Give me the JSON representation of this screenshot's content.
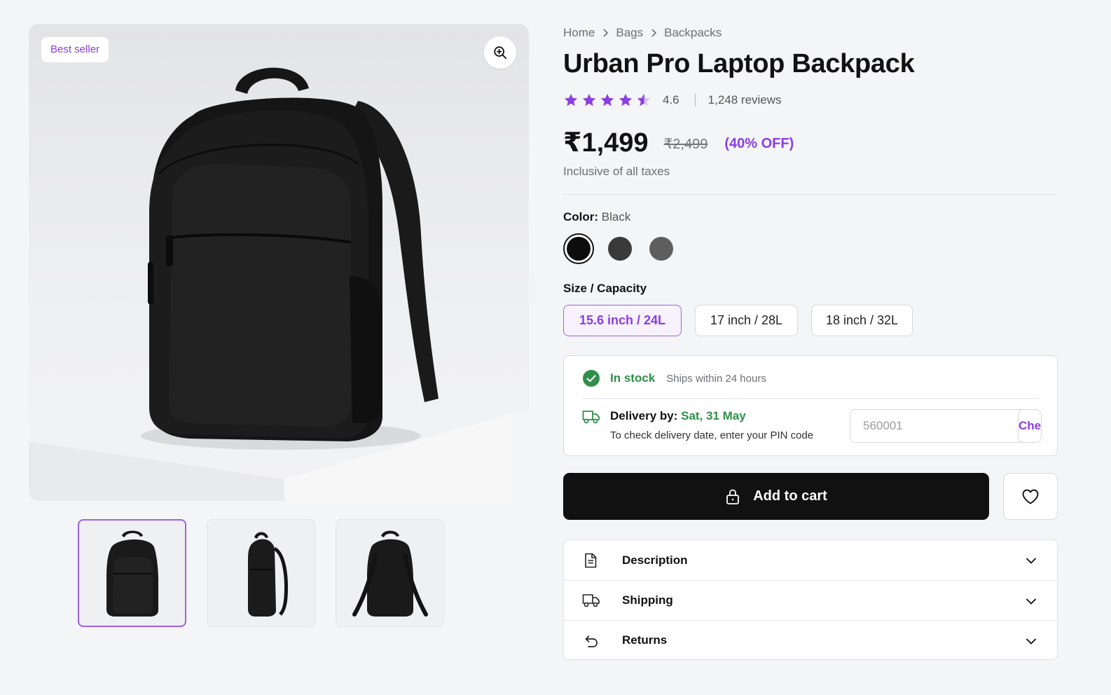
{
  "gallery": {
    "badge": "Best seller",
    "zoom_icon": "zoom-in-icon",
    "thumbnails": [
      {
        "view": "front",
        "selected": true
      },
      {
        "view": "side",
        "selected": false
      },
      {
        "view": "back",
        "selected": false
      }
    ]
  },
  "breadcrumb": [
    "Home",
    "Bags",
    "Backpacks"
  ],
  "product": {
    "title": "Urban Pro Laptop Backpack",
    "rating": "4.6",
    "rating_value": 4.6,
    "reviews": "1,248 reviews",
    "price": "₹1,499",
    "mrp": "₹2,499",
    "discount": "(40% OFF)",
    "tax_note": "Inclusive of all taxes"
  },
  "color": {
    "label": "Color:",
    "selected": "Black",
    "swatches": [
      {
        "name": "Black",
        "hex": "#0d0d0d",
        "selected": true
      },
      {
        "name": "Charcoal",
        "hex": "#3a3a3a",
        "selected": false
      },
      {
        "name": "Grey",
        "hex": "#5e5e5e",
        "selected": false
      }
    ]
  },
  "size": {
    "label": "Size / Capacity",
    "options": [
      {
        "label": "15.6 inch / 24L",
        "selected": true
      },
      {
        "label": "17 inch / 28L",
        "selected": false
      },
      {
        "label": "18 inch / 32L",
        "selected": false
      }
    ]
  },
  "availability": {
    "status": "In stock",
    "ships": "Ships within 24 hours",
    "delivery_label": "Delivery by:",
    "delivery_date": "Sat, 31 May",
    "delivery_hint": "To check delivery date, enter your PIN code",
    "pin_placeholder": "560001",
    "check_label": "Check"
  },
  "actions": {
    "add_to_cart": "Add to cart"
  },
  "accordion": [
    {
      "label": "Description",
      "icon": "document-icon"
    },
    {
      "label": "Shipping",
      "icon": "truck-icon"
    },
    {
      "label": "Returns",
      "icon": "return-arrow-icon"
    }
  ],
  "colors": {
    "accent": "#8a3ee0",
    "success": "#2f8f4a",
    "primary_button": "#111111"
  }
}
